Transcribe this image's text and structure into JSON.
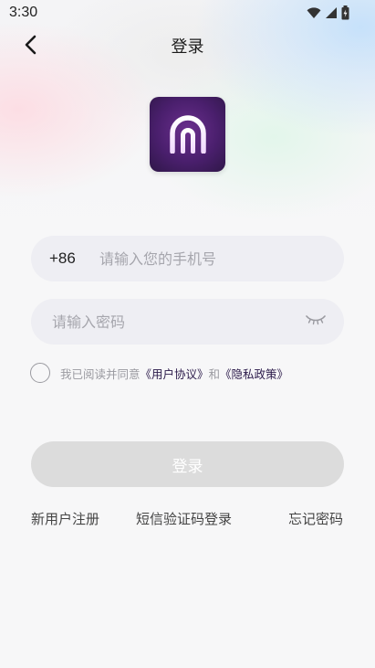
{
  "status_bar": {
    "time": "3:30",
    "icons": [
      "wifi-icon",
      "cellular-signal-icon",
      "battery-icon"
    ]
  },
  "header": {
    "back_icon": "chevron-left-icon",
    "title": "登录"
  },
  "logo": {
    "icon": "app-logo-arch"
  },
  "phone": {
    "country_code": "+86",
    "placeholder": "请输入您的手机号",
    "value": ""
  },
  "password": {
    "placeholder": "请输入密码",
    "value": "",
    "toggle_icon": "eye-closed-icon"
  },
  "agreement": {
    "checked": false,
    "prefix": "我已阅读并同意",
    "user_agreement": "《用户协议》",
    "and": "和",
    "privacy_policy": "《隐私政策》"
  },
  "login_button": {
    "label": "登录"
  },
  "links": {
    "register": "新用户注册",
    "sms_login": "短信验证码登录",
    "forgot_password": "忘记密码"
  },
  "colors": {
    "logo_purple": "#4a1f6d",
    "link_dark": "#2b1a4a",
    "button_disabled": "#dcdcdc",
    "field_bg": "#eeeef3"
  }
}
